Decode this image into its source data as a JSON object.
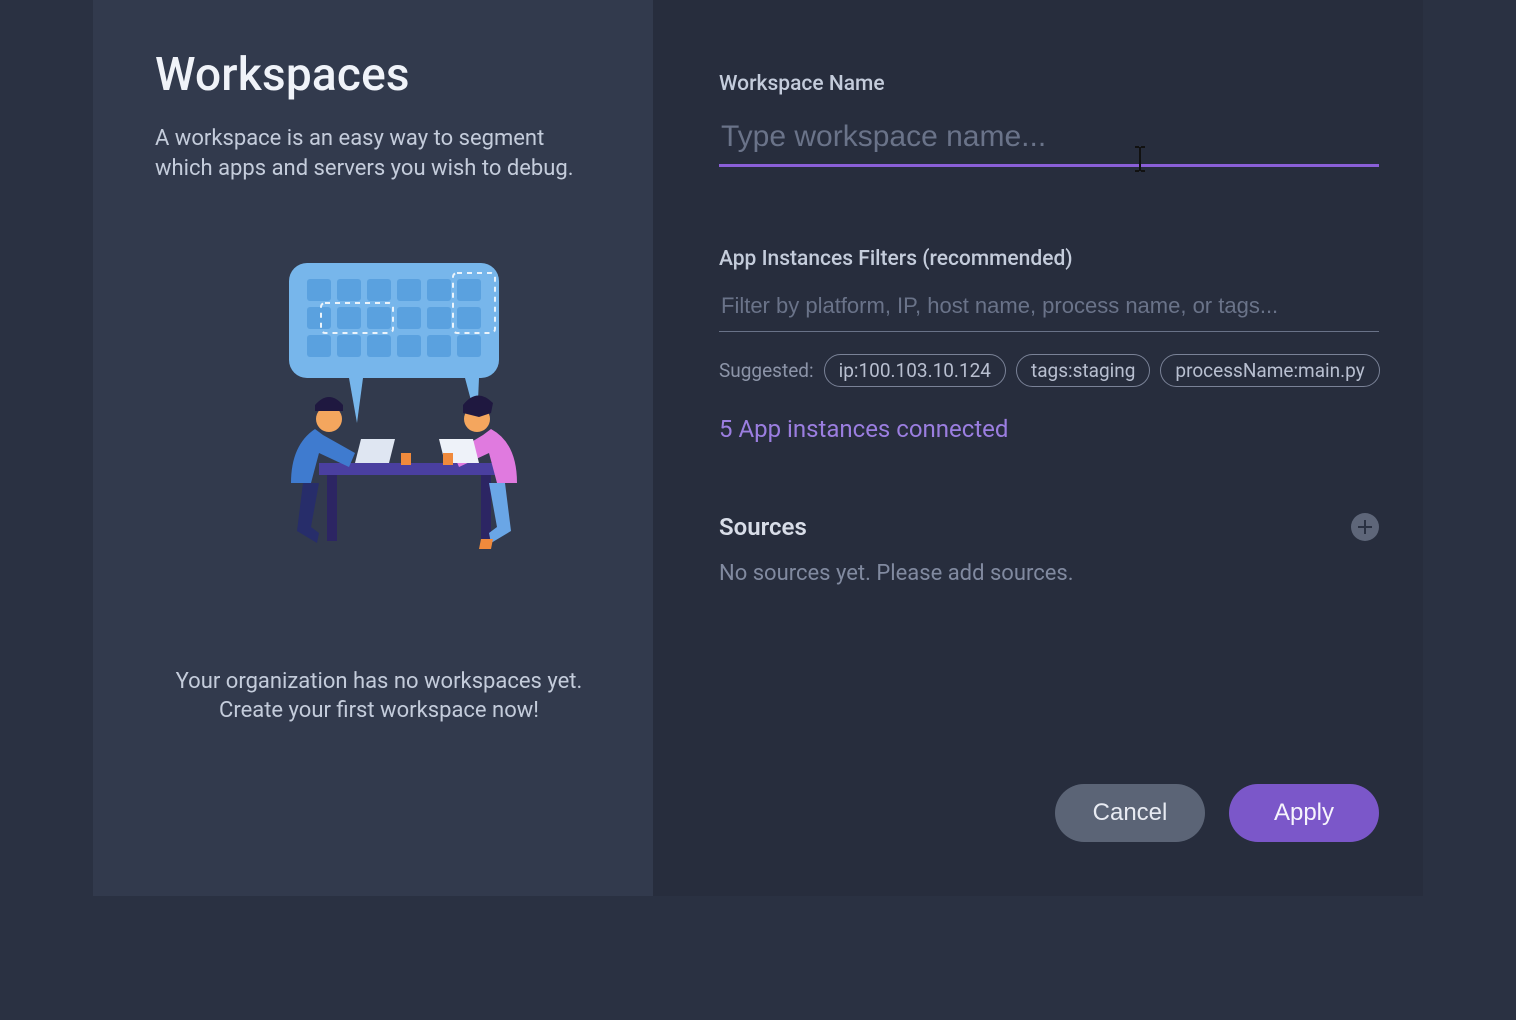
{
  "left": {
    "title": "Workspaces",
    "description": "A workspace is an easy way to segment which apps and servers you wish to debug.",
    "empty_org": "Your organization has no workspaces yet. Create your first workspace now!"
  },
  "form": {
    "name_label": "Workspace Name",
    "name_placeholder": "Type workspace name...",
    "name_value": "",
    "filters_label": "App Instances Filters (recommended)",
    "filters_placeholder": "Filter by platform, IP, host name, process name, or tags...",
    "filters_value": "",
    "suggested_label": "Suggested:",
    "suggested_chips": [
      "ip:100.103.10.124",
      "tags:staging",
      "processName:main.py"
    ],
    "connected": "5 App instances connected",
    "sources_label": "Sources",
    "sources_empty": "No sources yet. Please add sources."
  },
  "buttons": {
    "cancel": "Cancel",
    "apply": "Apply"
  },
  "colors": {
    "accent": "#8a5fd8",
    "link": "#9b7ee0"
  }
}
